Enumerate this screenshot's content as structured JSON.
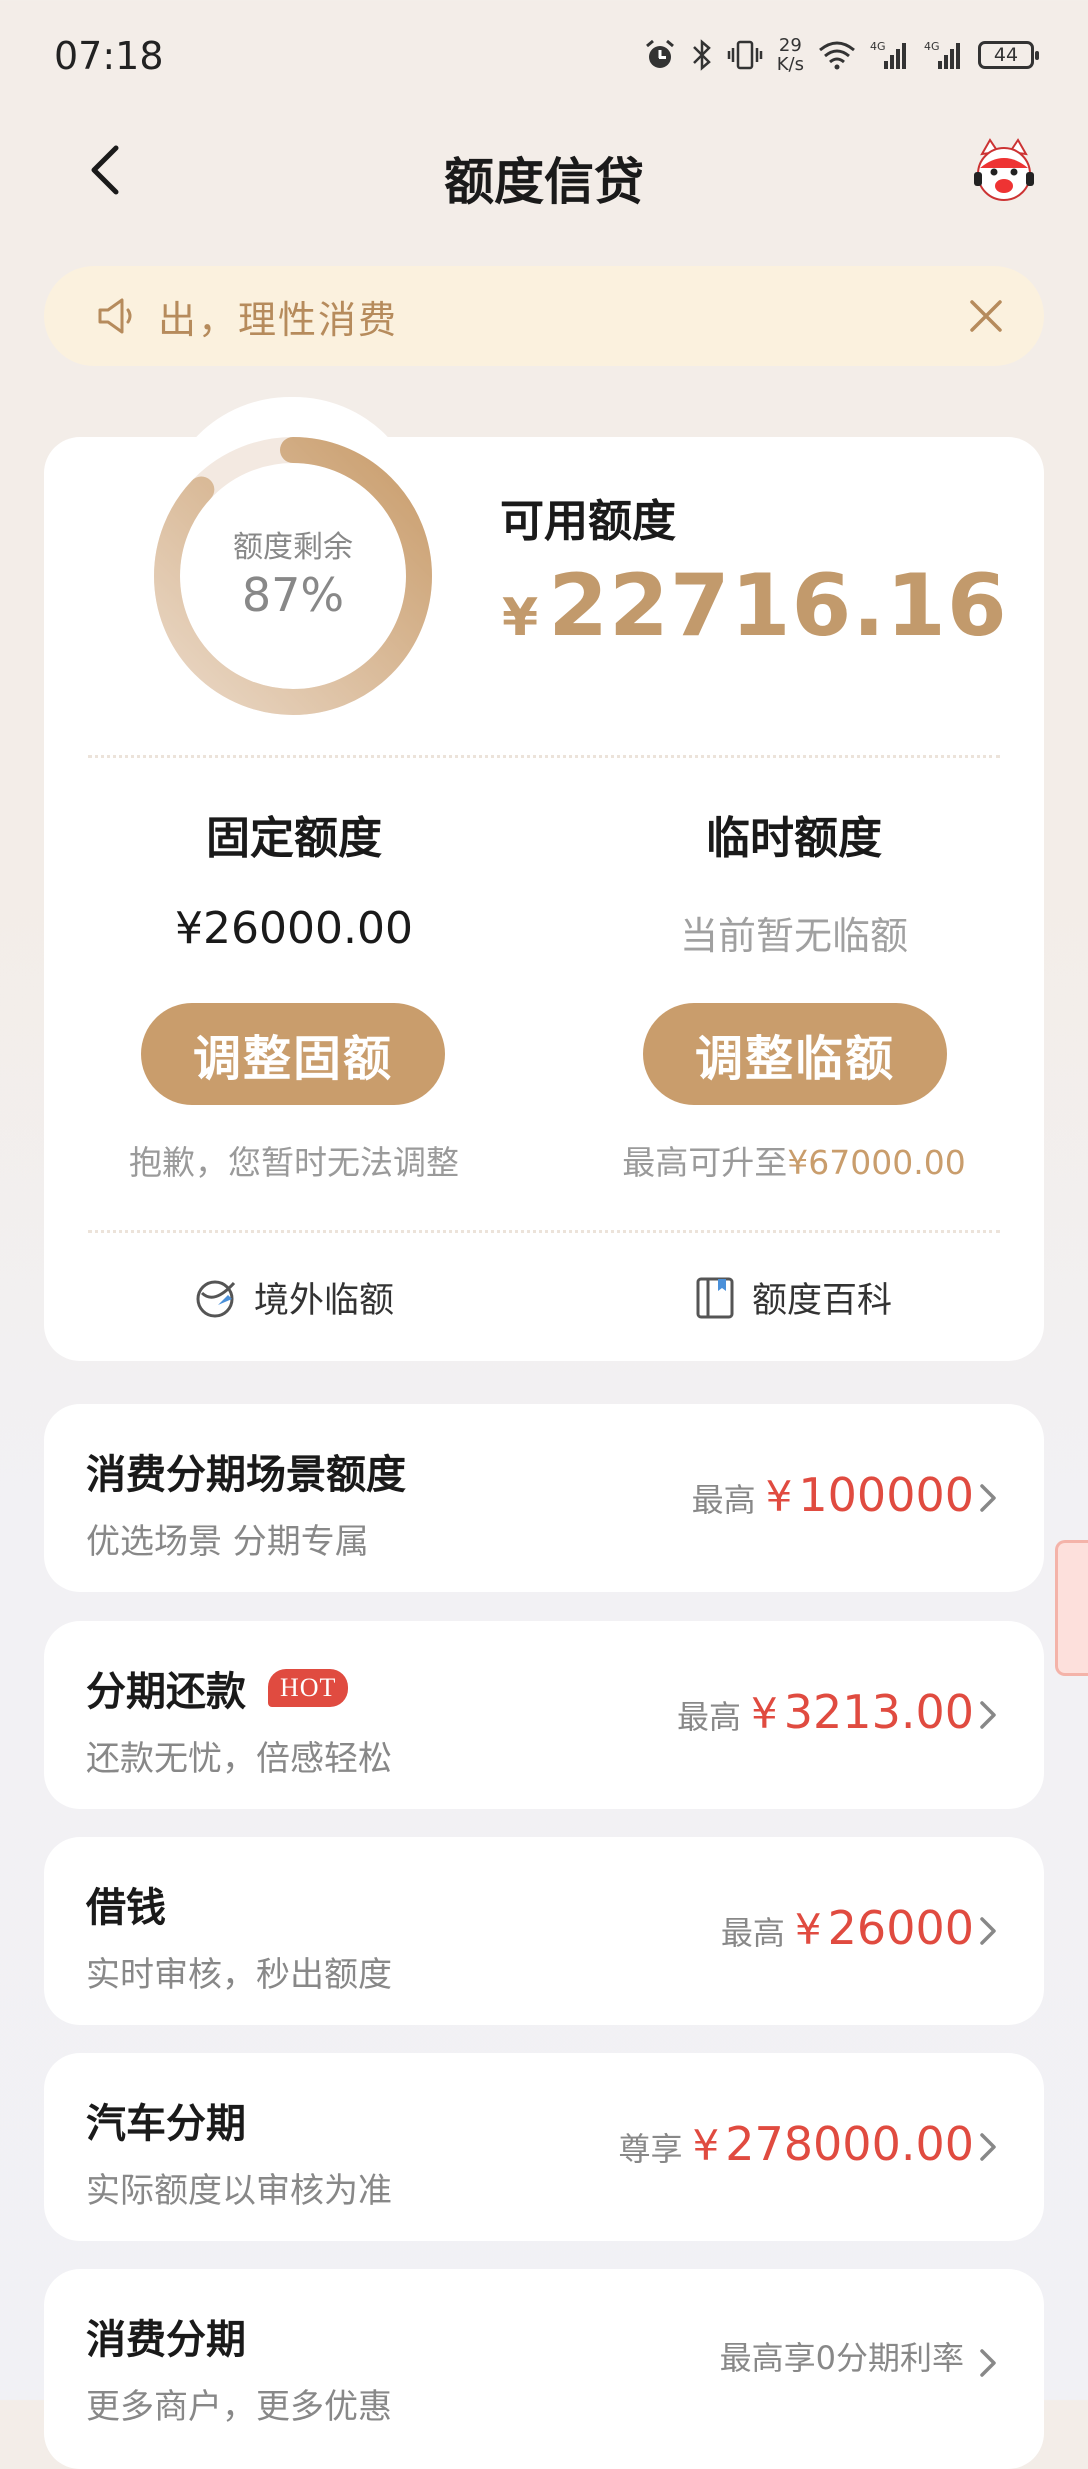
{
  "status_bar": {
    "time": "07:18",
    "speed_value": "29",
    "speed_unit": "K/s",
    "net1": "4G",
    "net2": "4G",
    "battery": "44"
  },
  "nav": {
    "title": "额度信贷",
    "back_icon": "chevron-left-icon",
    "service_icon": "mascot-service-icon"
  },
  "notice": {
    "text": "出，理性消费",
    "icon": "speaker-icon",
    "close_icon": "close-icon"
  },
  "credit": {
    "ring_label": "额度剩余",
    "ring_percent": "87%",
    "ring_fraction": 0.87,
    "available_label": "可用额度",
    "available_currency": "¥",
    "available_amount": "22716.16",
    "fixed": {
      "title": "固定额度",
      "value": "¥26000.00",
      "button": "调整固额",
      "note": "抱歉，您暂时无法调整"
    },
    "temp": {
      "title": "临时额度",
      "value": "当前暂无临额",
      "button": "调整临额",
      "note_prefix": "最高可升至",
      "note_amount": "¥67000.00"
    },
    "links": [
      {
        "label": "境外临额",
        "icon": "globe-plane-icon"
      },
      {
        "label": "额度百科",
        "icon": "book-icon"
      }
    ]
  },
  "products": [
    {
      "title": "消费分期场景额度",
      "subtitle": "优选场景 分期专属",
      "prefix": "最高",
      "currency": "¥",
      "amount": "100000"
    },
    {
      "title": "分期还款",
      "badge": "HOT",
      "subtitle": "还款无忧，倍感轻松",
      "prefix": "最高",
      "currency": "¥",
      "amount": "3213.00"
    },
    {
      "title": "借钱",
      "subtitle": "实时审核，秒出额度",
      "prefix": "最高",
      "currency": "¥",
      "amount": "26000"
    },
    {
      "title": "汽车分期",
      "subtitle": "实际额度以审核为准",
      "prefix": "尊享",
      "currency": "¥",
      "amount": "278000.00"
    },
    {
      "title": "消费分期",
      "subtitle": "更多商户，更多优惠",
      "prefix": "最高享0分期利率"
    }
  ],
  "colors": {
    "gold": "#c99d6c",
    "red": "#e04b40",
    "notice_bg": "#fbf1de"
  }
}
